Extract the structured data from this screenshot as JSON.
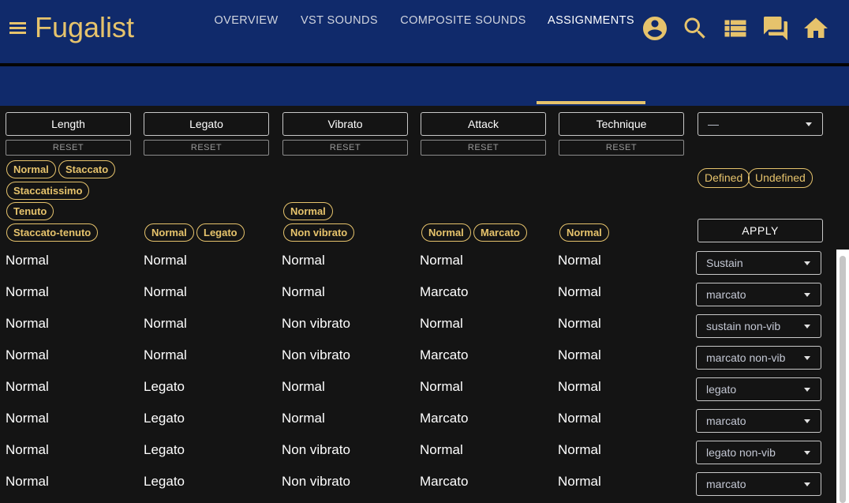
{
  "app": {
    "title": "Fugalist"
  },
  "header_icons": [
    "account-circle-icon",
    "search-icon",
    "list-icon",
    "forum-icon",
    "home-icon"
  ],
  "tabs": [
    {
      "label": "OVERVIEW"
    },
    {
      "label": "VST SOUNDS"
    },
    {
      "label": "COMPOSITE SOUNDS"
    },
    {
      "label": "ASSIGNMENTS",
      "active": true
    }
  ],
  "filters": [
    {
      "label": "Length",
      "reset": "RESET"
    },
    {
      "label": "Legato",
      "reset": "RESET"
    },
    {
      "label": "Vibrato",
      "reset": "RESET"
    },
    {
      "label": "Attack",
      "reset": "RESET"
    },
    {
      "label": "Technique",
      "reset": "RESET"
    }
  ],
  "chips": {
    "length": [
      "Normal",
      "Staccato",
      "Staccatissimo",
      "Tenuto",
      "Staccato-tenuto"
    ],
    "legato": [
      "Normal",
      "Legato"
    ],
    "vibrato": [
      "Normal",
      "Non vibrato"
    ],
    "attack": [
      "Normal",
      "Marcato"
    ],
    "technique": [
      "Normal"
    ],
    "status": [
      "Defined",
      "Undefined"
    ]
  },
  "assignment_filter": {
    "value": "—"
  },
  "apply_label": "APPLY",
  "rows": [
    [
      "Normal",
      "Normal",
      "Normal",
      "Normal",
      "Normal",
      "Sustain"
    ],
    [
      "Normal",
      "Normal",
      "Normal",
      "Marcato",
      "Normal",
      "marcato"
    ],
    [
      "Normal",
      "Normal",
      "Non vibrato",
      "Normal",
      "Normal",
      "sustain non-vib"
    ],
    [
      "Normal",
      "Normal",
      "Non vibrato",
      "Marcato",
      "Normal",
      "marcato non-vib"
    ],
    [
      "Normal",
      "Legato",
      "Normal",
      "Normal",
      "Normal",
      "legato"
    ],
    [
      "Normal",
      "Legato",
      "Normal",
      "Marcato",
      "Normal",
      "marcato"
    ],
    [
      "Normal",
      "Legato",
      "Non vibrato",
      "Normal",
      "Normal",
      "legato non-vib"
    ],
    [
      "Normal",
      "Legato",
      "Non vibrato",
      "Marcato",
      "Normal",
      "marcato"
    ]
  ],
  "colors": {
    "appbar": "#102a6b",
    "accent": "#e6c36c",
    "background": "#141414"
  }
}
